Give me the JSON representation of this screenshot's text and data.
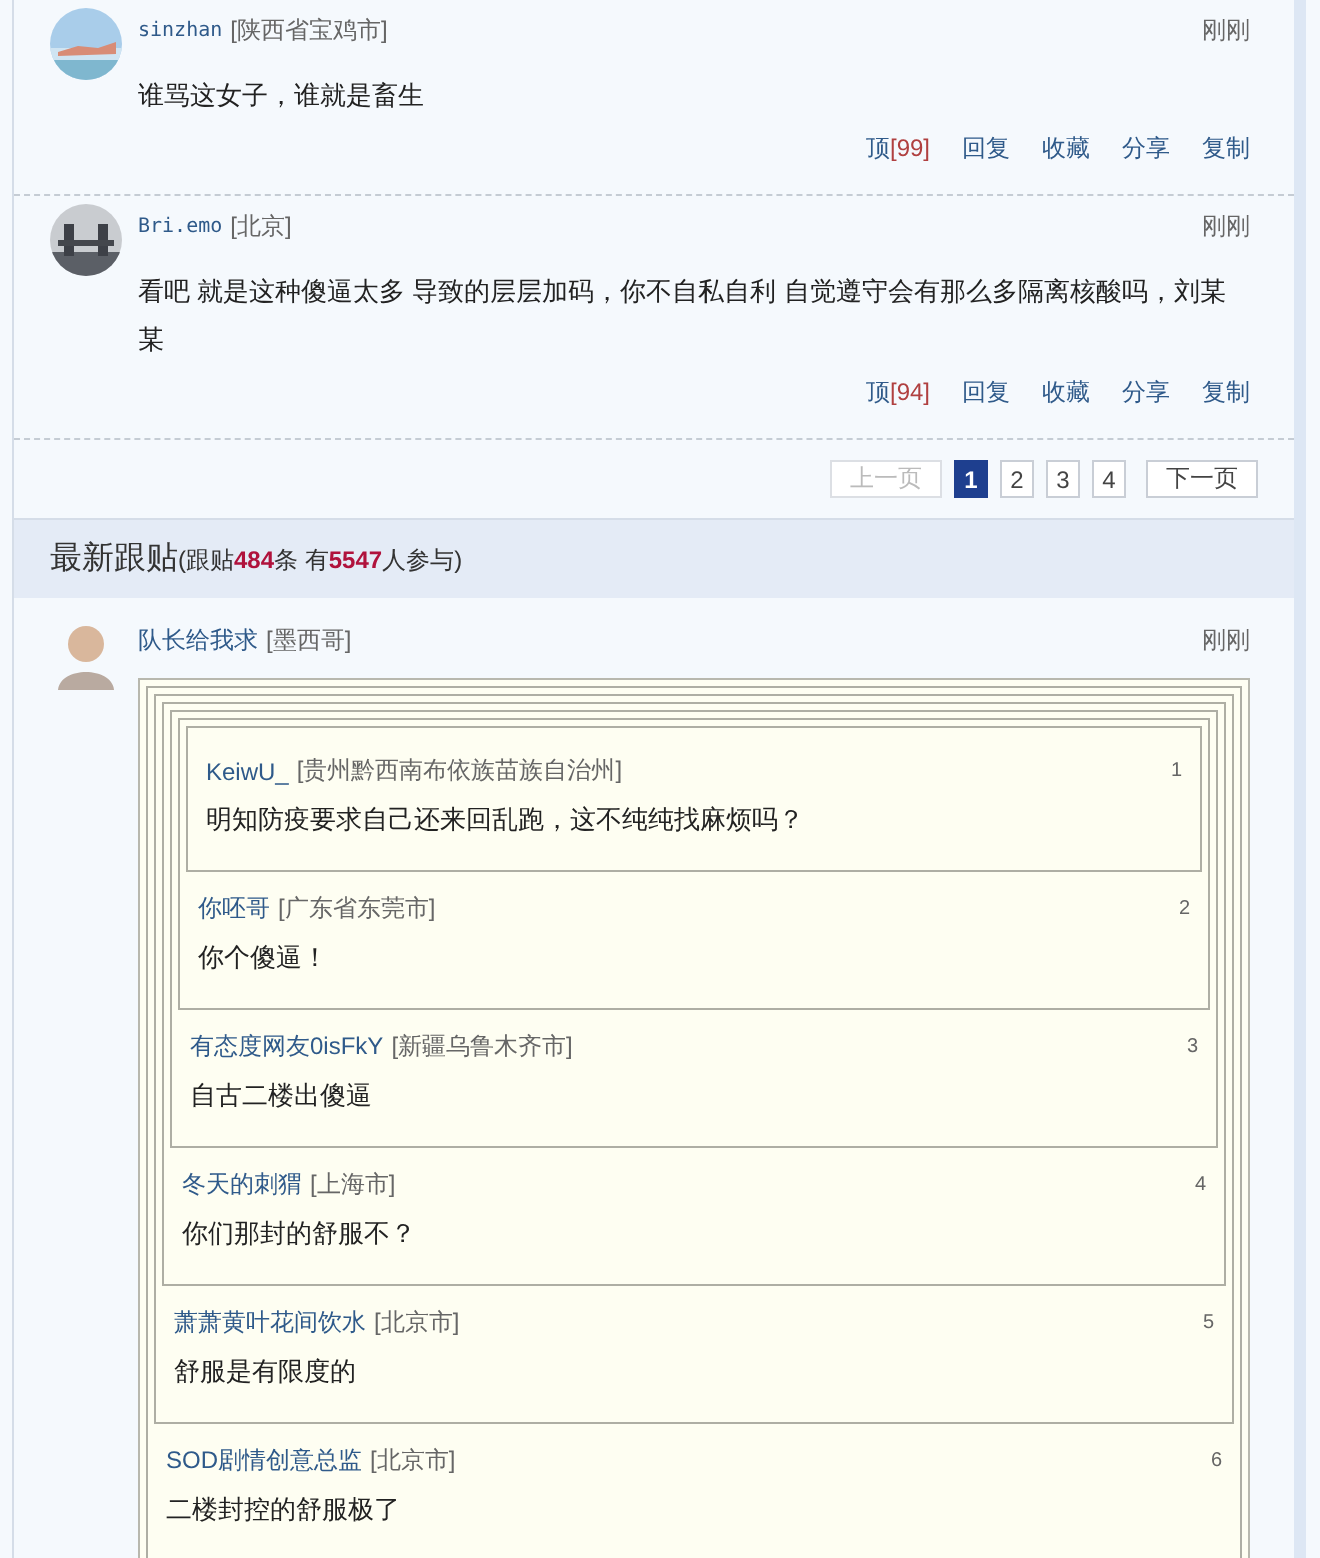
{
  "comments": [
    {
      "user": "sinzhan",
      "location": "[陕西省宝鸡市]",
      "time": "刚刚",
      "text": "谁骂这女子，谁就是畜生",
      "vote_label": "顶",
      "vote_count": "[99]",
      "actions": [
        "回复",
        "收藏",
        "分享",
        "复制"
      ]
    },
    {
      "user": "Bri.emo",
      "location": "[北京]",
      "time": "刚刚",
      "text": "看吧  就是这种傻逼太多  导致的层层加码，你不自私自利  自觉遵守会有那么多隔离核酸吗，刘某某",
      "vote_label": "顶",
      "vote_count": "[94]",
      "actions": [
        "回复",
        "收藏",
        "分享",
        "复制"
      ]
    }
  ],
  "pagination": {
    "prev": {
      "label": "上一页",
      "disabled": true
    },
    "pages": [
      {
        "label": "1",
        "selected": true
      },
      {
        "label": "2",
        "selected": false
      },
      {
        "label": "3",
        "selected": false
      },
      {
        "label": "4",
        "selected": false
      }
    ],
    "next": {
      "label": "下一页",
      "disabled": false
    }
  },
  "latest": {
    "title": "最新跟贴",
    "summary": "(跟贴**484**条  有**5547**人参与)",
    "comment": {
      "user": "队长给我求",
      "location": "[墨西哥]",
      "time": "刚刚",
      "quote": {
        "number": "6",
        "user": "SOD剧情创意总监",
        "location": "[北京市]",
        "text": "二楼封控的舒服极了",
        "quote": {
          "number": "5",
          "user": "萧萧黄叶花间饮水",
          "location": "[北京市]",
          "text": "舒服是有限度的",
          "quote": {
            "number": "4",
            "user": "冬天的刺猬",
            "location": "[上海市]",
            "text": "你们那封的舒服不？",
            "quote": {
              "number": "3",
              "user": "有态度网友0isFkY",
              "location": "[新疆乌鲁木齐市]",
              "text": "自古二楼出傻逼",
              "quote": {
                "number": "2",
                "user": "你呸哥",
                "location": "[广东省东莞市]",
                "text": "你个傻逼！",
                "quote": {
                  "number": "1",
                  "user": "KeiwU_",
                  "location": "[贵州黔西南布依族苗族自治州]",
                  "text": "明知防疫要求自己还来回乱跑，这不纯纯找麻烦吗？"
                }
              }
            }
          }
        }
      }
    }
  }
}
